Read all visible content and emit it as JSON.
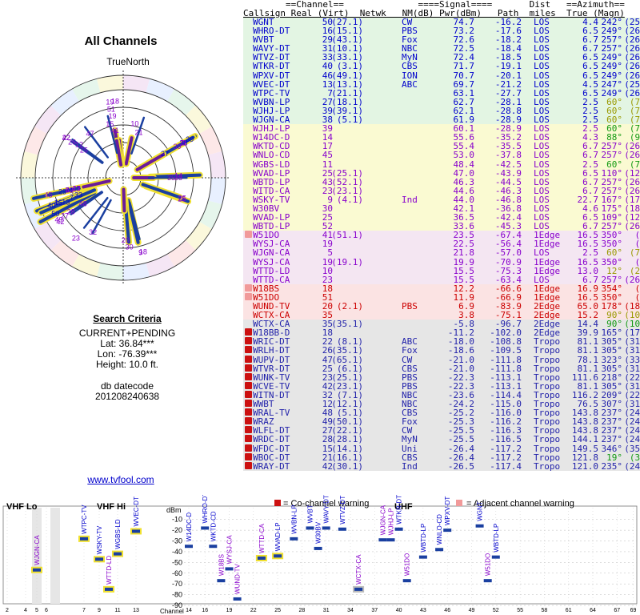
{
  "page": {
    "title": "All Channels",
    "true_north": "TrueNorth",
    "criteria_heading": "Search Criteria",
    "criteria_mode": "CURRENT+PENDING",
    "lat": "Lat: 36.84***",
    "lon": "Lon: -76.39***",
    "height": "Height: 10.0 ft.",
    "db_label": "db datecode",
    "db_value": "201208240638",
    "link": "www.tvfool.com"
  },
  "table": {
    "header1": "        ==Channel==              ====Signal====       Dist   ==Azimuth==",
    "header2": "Callsign Real (Virt)  Netwk   NM(dB) Pwr(dBm)   Path  miles  True (Magn)",
    "columns": [
      "Callsign",
      "Real",
      "(Virt)",
      "Netwk",
      "NM(dB)",
      "Pwr(dBm)",
      "Path",
      "Dist miles",
      "True",
      "(Magn)"
    ],
    "rows": [
      {
        "cs": "WGNT",
        "real": "50",
        "virt": "(27.1)",
        "net": "CW",
        "nm": "74.7",
        "pwr": "-16.2",
        "path": "LOS",
        "dist": "4.4",
        "tru": "242°",
        "mag": "(252°)",
        "grp": "g"
      },
      {
        "cs": "WHRO-DT",
        "real": "16",
        "virt": "(15.1)",
        "net": "PBS",
        "nm": "73.2",
        "pwr": "-17.6",
        "path": "LOS",
        "dist": "6.5",
        "tru": "249°",
        "mag": "(260°)",
        "grp": "g"
      },
      {
        "cs": "WVBT",
        "real": "29",
        "virt": "(43.1)",
        "net": "Fox",
        "nm": "72.6",
        "pwr": "-18.2",
        "path": "LOS",
        "dist": "6.7",
        "tru": "257°",
        "mag": "(268°)",
        "grp": "g"
      },
      {
        "cs": "WAVY-DT",
        "real": "31",
        "virt": "(10.1)",
        "net": "NBC",
        "nm": "72.5",
        "pwr": "-18.4",
        "path": "LOS",
        "dist": "6.7",
        "tru": "257°",
        "mag": "(268°)",
        "grp": "g"
      },
      {
        "cs": "WTVZ-DT",
        "real": "33",
        "virt": "(33.1)",
        "net": "MyN",
        "nm": "72.4",
        "pwr": "-18.5",
        "path": "LOS",
        "dist": "6.5",
        "tru": "249°",
        "mag": "(260°)",
        "grp": "g"
      },
      {
        "cs": "WTKR-DT",
        "real": "40",
        "virt": "(3.1)",
        "net": "CBS",
        "nm": "71.7",
        "pwr": "-19.1",
        "path": "LOS",
        "dist": "6.5",
        "tru": "249°",
        "mag": "(260°)",
        "grp": "g"
      },
      {
        "cs": "WPXV-DT",
        "real": "46",
        "virt": "(49.1)",
        "net": "ION",
        "nm": "70.7",
        "pwr": "-20.1",
        "path": "LOS",
        "dist": "6.5",
        "tru": "249°",
        "mag": "(260°)",
        "grp": "g"
      },
      {
        "cs": "WVEC-DT",
        "real": "13",
        "virt": "(13.1)",
        "net": "ABC",
        "nm": "69.7",
        "pwr": "-21.2",
        "path": "LOS",
        "dist": "4.5",
        "tru": "247°",
        "mag": "(258°)",
        "grp": "g"
      },
      {
        "cs": "WTPC-TV",
        "real": "7",
        "virt": "(21.1)",
        "net": "",
        "nm": "63.1",
        "pwr": "-27.7",
        "path": "LOS",
        "dist": "6.5",
        "tru": "249°",
        "mag": "(260°)",
        "grp": "g"
      },
      {
        "cs": "WVBN-LP",
        "real": "27",
        "virt": "(18.1)",
        "net": "",
        "nm": "62.7",
        "pwr": "-28.1",
        "path": "LOS",
        "dist": "2.5",
        "tru": "60°",
        "mag": "(70°)",
        "grp": "g"
      },
      {
        "cs": "WJHJ-LP",
        "real": "39",
        "virt": "(39.1)",
        "net": "",
        "nm": "62.1",
        "pwr": "-28.8",
        "path": "LOS",
        "dist": "2.5",
        "tru": "60°",
        "mag": "(70°)",
        "grp": "g"
      },
      {
        "cs": "WJGN-CA",
        "real": "38",
        "virt": "(5.1)",
        "net": "",
        "nm": "61.9",
        "pwr": "-28.9",
        "path": "LOS",
        "dist": "2.5",
        "tru": "60°",
        "mag": "(70°)",
        "grp": "g"
      },
      {
        "cs": "WJHJ-LP",
        "real": "39",
        "virt": "",
        "net": "",
        "nm": "60.1",
        "pwr": "-28.9",
        "path": "LOS",
        "dist": "2.5",
        "tru": "60°",
        "mag": "(70°)",
        "grp": "y"
      },
      {
        "cs": "W14DC-D",
        "real": "14",
        "virt": "",
        "net": "",
        "nm": "55.6",
        "pwr": "-35.2",
        "path": "LOS",
        "dist": "4.3",
        "tru": "88°",
        "mag": "(98°)",
        "grp": "y"
      },
      {
        "cs": "WKTD-CD",
        "real": "17",
        "virt": "",
        "net": "",
        "nm": "55.4",
        "pwr": "-35.5",
        "path": "LOS",
        "dist": "6.7",
        "tru": "257°",
        "mag": "(268°)",
        "grp": "y"
      },
      {
        "cs": "WNLO-CD",
        "real": "45",
        "virt": "",
        "net": "",
        "nm": "53.0",
        "pwr": "-37.8",
        "path": "LOS",
        "dist": "6.7",
        "tru": "257°",
        "mag": "(268°)",
        "grp": "y"
      },
      {
        "cs": "WGBS-LD",
        "real": "11",
        "virt": "",
        "net": "",
        "nm": "48.4",
        "pwr": "-42.5",
        "path": "LOS",
        "dist": "2.5",
        "tru": "60°",
        "mag": "(70°)",
        "grp": "y"
      },
      {
        "cs": "WVAD-LP",
        "real": "25",
        "virt": "(25.1)",
        "net": "",
        "nm": "47.0",
        "pwr": "-43.9",
        "path": "LOS",
        "dist": "6.5",
        "tru": "110°",
        "mag": "(120°)",
        "grp": "y"
      },
      {
        "cs": "WBTD-LP",
        "real": "43",
        "virt": "(52.1)",
        "net": "",
        "nm": "46.3",
        "pwr": "-44.5",
        "path": "LOS",
        "dist": "6.7",
        "tru": "257°",
        "mag": "(268°)",
        "grp": "y"
      },
      {
        "cs": "WITD-CA",
        "real": "23",
        "virt": "(23.1)",
        "net": "",
        "nm": "44.6",
        "pwr": "-46.3",
        "path": "LOS",
        "dist": "6.7",
        "tru": "257°",
        "mag": "(268°)",
        "grp": "y"
      },
      {
        "cs": "WSKY-TV",
        "real": "9",
        "virt": "(4.1)",
        "net": "Ind",
        "nm": "44.0",
        "pwr": "-46.8",
        "path": "LOS",
        "dist": "22.7",
        "tru": "167°",
        "mag": "(178°)",
        "grp": "y"
      },
      {
        "cs": "W30BV",
        "real": "30",
        "virt": "",
        "net": "",
        "nm": "42.1",
        "pwr": "-36.8",
        "path": "LOS",
        "dist": "4.6",
        "tru": "175°",
        "mag": "(186°)",
        "grp": "y"
      },
      {
        "cs": "WVAD-LP",
        "real": "25",
        "virt": "",
        "net": "",
        "nm": "36.5",
        "pwr": "-42.4",
        "path": "LOS",
        "dist": "6.5",
        "tru": "109°",
        "mag": "(120°)",
        "grp": "y"
      },
      {
        "cs": "WBTD-LP",
        "real": "52",
        "virt": "",
        "net": "",
        "nm": "33.6",
        "pwr": "-45.3",
        "path": "LOS",
        "dist": "6.7",
        "tru": "257°",
        "mag": "(268°)",
        "grp": "y"
      },
      {
        "cs": "W51DO",
        "real": "41",
        "virt": "(51.1)",
        "net": "",
        "nm": "23.5",
        "pwr": "-67.4",
        "path": "1Edge",
        "dist": "16.5",
        "tru": "350°",
        "mag": "(0°)",
        "grp": "p",
        "mk": "adj"
      },
      {
        "cs": "WYSJ-CA",
        "real": "19",
        "virt": "",
        "net": "",
        "nm": "22.5",
        "pwr": "-56.4",
        "path": "1Edge",
        "dist": "16.5",
        "tru": "350°",
        "mag": "(0°)",
        "grp": "p"
      },
      {
        "cs": "WJGN-CA",
        "real": "5",
        "virt": "",
        "net": "",
        "nm": "21.8",
        "pwr": "-57.0",
        "path": "LOS",
        "dist": "2.5",
        "tru": "60°",
        "mag": "(70°)",
        "grp": "p"
      },
      {
        "cs": "WYSJ-CA",
        "real": "19",
        "virt": "(19.1)",
        "net": "",
        "nm": "19.9",
        "pwr": "-70.9",
        "path": "1Edge",
        "dist": "16.5",
        "tru": "350°",
        "mag": "(0°)",
        "grp": "p"
      },
      {
        "cs": "WTTD-LD",
        "real": "10",
        "virt": "",
        "net": "",
        "nm": "15.5",
        "pwr": "-75.3",
        "path": "1Edge",
        "dist": "13.0",
        "tru": "12°",
        "mag": "(23°)",
        "grp": "p"
      },
      {
        "cs": "WTTD-CA",
        "real": "23",
        "virt": "",
        "net": "",
        "nm": "15.5",
        "pwr": "-63.4",
        "path": "LOS",
        "dist": "6.7",
        "tru": "257°",
        "mag": "(268°)",
        "grp": "p"
      },
      {
        "cs": "W18BS",
        "real": "18",
        "virt": "",
        "net": "",
        "nm": "12.2",
        "pwr": "-66.6",
        "path": "1Edge",
        "dist": "16.9",
        "tru": "354°",
        "mag": "(4°)",
        "grp": "r",
        "mk": "adj"
      },
      {
        "cs": "W51DO",
        "real": "51",
        "virt": "",
        "net": "",
        "nm": "11.9",
        "pwr": "-66.9",
        "path": "1Edge",
        "dist": "16.5",
        "tru": "350°",
        "mag": "(0°)",
        "grp": "r",
        "mk": "adj"
      },
      {
        "cs": "WUND-TV",
        "real": "20",
        "virt": "(2.1)",
        "net": "PBS",
        "nm": "6.9",
        "pwr": "-83.9",
        "path": "2Edge",
        "dist": "65.0",
        "tru": "178°",
        "mag": "(188°)",
        "grp": "r"
      },
      {
        "cs": "WCTX-CA",
        "real": "35",
        "virt": "",
        "net": "",
        "nm": "3.8",
        "pwr": "-75.1",
        "path": "2Edge",
        "dist": "15.2",
        "tru": "90°",
        "mag": "(100°)",
        "grp": "r"
      },
      {
        "cs": "WCTX-CA",
        "real": "35",
        "virt": "(35.1)",
        "net": "",
        "nm": "-5.8",
        "pwr": "-96.7",
        "path": "2Edge",
        "dist": "14.4",
        "tru": "90°",
        "mag": "(100°)",
        "grp": "k"
      },
      {
        "cs": "W18BB-D",
        "real": "18",
        "virt": "",
        "net": "",
        "nm": "-11.2",
        "pwr": "-102.0",
        "path": "2Edge",
        "dist": "39.9",
        "tru": "165°",
        "mag": "(176°)",
        "grp": "k",
        "mk": "co"
      },
      {
        "cs": "WRIC-DT",
        "real": "22",
        "virt": "(8.1)",
        "net": "ABC",
        "nm": "-18.0",
        "pwr": "-108.8",
        "path": "Tropo",
        "dist": "81.1",
        "tru": "305°",
        "mag": "(316°)",
        "grp": "k",
        "mk": "co"
      },
      {
        "cs": "WRLH-DT",
        "real": "26",
        "virt": "(35.1)",
        "net": "Fox",
        "nm": "-18.6",
        "pwr": "-109.5",
        "path": "Tropo",
        "dist": "81.1",
        "tru": "305°",
        "mag": "(316°)",
        "grp": "k",
        "mk": "co"
      },
      {
        "cs": "WUPV-DT",
        "real": "47",
        "virt": "(65.1)",
        "net": "CW",
        "nm": "-21.0",
        "pwr": "-111.8",
        "path": "Tropo",
        "dist": "78.1",
        "tru": "323°",
        "mag": "(333°)",
        "grp": "k",
        "mk": "co"
      },
      {
        "cs": "WTVR-DT",
        "real": "25",
        "virt": "(6.1)",
        "net": "CBS",
        "nm": "-21.0",
        "pwr": "-111.8",
        "path": "Tropo",
        "dist": "81.1",
        "tru": "305°",
        "mag": "(316°)",
        "grp": "k",
        "mk": "co"
      },
      {
        "cs": "WUNK-TV",
        "real": "23",
        "virt": "(25.1)",
        "net": "PBS",
        "nm": "-22.3",
        "pwr": "-113.1",
        "path": "Tropo",
        "dist": "111.6",
        "tru": "218°",
        "mag": "(228°)",
        "grp": "k",
        "mk": "co"
      },
      {
        "cs": "WCVE-TV",
        "real": "42",
        "virt": "(23.1)",
        "net": "PBS",
        "nm": "-22.3",
        "pwr": "-113.1",
        "path": "Tropo",
        "dist": "81.1",
        "tru": "305°",
        "mag": "(316°)",
        "grp": "k",
        "mk": "co"
      },
      {
        "cs": "WITN-DT",
        "real": "32",
        "virt": "(7.1)",
        "net": "NBC",
        "nm": "-23.6",
        "pwr": "-114.4",
        "path": "Tropo",
        "dist": "116.2",
        "tru": "209°",
        "mag": "(220°)",
        "grp": "k",
        "mk": "co"
      },
      {
        "cs": "WWBT",
        "real": "12",
        "virt": "(12.1)",
        "net": "NBC",
        "nm": "-24.2",
        "pwr": "-115.0",
        "path": "Tropo",
        "dist": "76.5",
        "tru": "307°",
        "mag": "(318°)",
        "grp": "k",
        "mk": "co"
      },
      {
        "cs": "WRAL-TV",
        "real": "48",
        "virt": "(5.1)",
        "net": "CBS",
        "nm": "-25.2",
        "pwr": "-116.0",
        "path": "Tropo",
        "dist": "143.8",
        "tru": "237°",
        "mag": "(247°)",
        "grp": "k",
        "mk": "co"
      },
      {
        "cs": "WRAZ",
        "real": "49",
        "virt": "(50.1)",
        "net": "Fox",
        "nm": "-25.3",
        "pwr": "-116.2",
        "path": "Tropo",
        "dist": "143.8",
        "tru": "237°",
        "mag": "(247°)",
        "grp": "k",
        "mk": "co"
      },
      {
        "cs": "WLFL-DT",
        "real": "27",
        "virt": "(22.1)",
        "net": "CW",
        "nm": "-25.5",
        "pwr": "-116.3",
        "path": "Tropo",
        "dist": "143.8",
        "tru": "237°",
        "mag": "(247°)",
        "grp": "k",
        "mk": "co"
      },
      {
        "cs": "WRDC-DT",
        "real": "28",
        "virt": "(28.1)",
        "net": "MyN",
        "nm": "-25.5",
        "pwr": "-116.5",
        "path": "Tropo",
        "dist": "144.1",
        "tru": "237°",
        "mag": "(247°)",
        "grp": "k",
        "mk": "co"
      },
      {
        "cs": "WFDC-DT",
        "real": "15",
        "virt": "(14.1)",
        "net": "Uni",
        "nm": "-26.4",
        "pwr": "-117.2",
        "path": "Tropo",
        "dist": "149.5",
        "tru": "346°",
        "mag": "(356°)",
        "grp": "k",
        "mk": "co"
      },
      {
        "cs": "WBOC-DT",
        "real": "21",
        "virty": "",
        "virt": "(16.1)",
        "net": "CBS",
        "nm": "-26.4",
        "pwr": "-117.2",
        "path": "Tropo",
        "dist": "121.8",
        "tru": "19°",
        "mag": "(30°)",
        "grp": "k",
        "mk": "co"
      },
      {
        "cs": "WRAY-DT",
        "real": "42",
        "virt": "(30.1)",
        "net": "Ind",
        "nm": "-26.5",
        "pwr": "-117.4",
        "path": "Tropo",
        "dist": "121.0",
        "tru": "235°",
        "mag": "(246°)",
        "grp": "k",
        "mk": "co"
      }
    ]
  },
  "spectrum": {
    "vhf_lo": "VHF Lo",
    "vhf_hi": "VHF Hi",
    "uhf": "UHF",
    "co_warning": "= Co-channel warning",
    "adj_warning": "= Adjacent channel warning",
    "dbm_label": "dBm",
    "channel_label": "Channel",
    "dbm_ticks": [
      "-10",
      "-20",
      "-30",
      "-40",
      "-50",
      "-60",
      "-70",
      "-80",
      "-90"
    ],
    "ch_ticks": [
      "2",
      "4",
      "5",
      "6",
      "7",
      "9",
      "11",
      "13",
      "14",
      "16",
      "19",
      "22",
      "25",
      "28",
      "31",
      "34",
      "37",
      "40",
      "43",
      "46",
      "49",
      "52",
      "55",
      "58",
      "61",
      "64",
      "67",
      "69"
    ],
    "stations": [
      {
        "label": "WJGN-CA",
        "ch": 5,
        "dbm": -57,
        "hl": "y"
      },
      {
        "label": "WTPC-TV",
        "ch": 7,
        "dbm": -28,
        "hl": "y"
      },
      {
        "label": "WSKY-TV",
        "ch": 9,
        "dbm": -47,
        "hl": "y"
      },
      {
        "label": "WTTD-LD",
        "ch": 10,
        "dbm": -75,
        "hl": "y"
      },
      {
        "label": "WGBS-LD",
        "ch": 11,
        "dbm": -42,
        "hl": "y"
      },
      {
        "label": "WVEC-DT",
        "ch": 13,
        "dbm": -21,
        "hl": "y"
      },
      {
        "label": "W14DC-D",
        "ch": 14,
        "dbm": -35,
        "hl": ""
      },
      {
        "label": "WHRO-DT",
        "ch": 16,
        "dbm": -18,
        "hl": ""
      },
      {
        "label": "WKTD-CD",
        "ch": 17,
        "dbm": -35,
        "hl": ""
      },
      {
        "label": "W18BS",
        "ch": 18,
        "dbm": -67,
        "hl": ""
      },
      {
        "label": "WYSJ-CA",
        "ch": 19,
        "dbm": -56,
        "hl": ""
      },
      {
        "label": "WUND-TV",
        "ch": 20,
        "dbm": -84,
        "hl": ""
      },
      {
        "label": "WTTD-CA",
        "ch": 23,
        "dbm": -46,
        "hl": "y"
      },
      {
        "label": "WVAD-LP",
        "ch": 25,
        "dbm": -44,
        "hl": "y"
      },
      {
        "label": "WVBN-LP",
        "ch": 27,
        "dbm": -28,
        "hl": ""
      },
      {
        "label": "WVBT",
        "ch": 29,
        "dbm": -18,
        "hl": ""
      },
      {
        "label": "W30BV",
        "ch": 30,
        "dbm": -37,
        "hl": ""
      },
      {
        "label": "WAVY-DT",
        "ch": 31,
        "dbm": -18,
        "hl": ""
      },
      {
        "label": "WTVZ-DT",
        "ch": 33,
        "dbm": -19,
        "hl": ""
      },
      {
        "label": "WCTX-CA",
        "ch": 35,
        "dbm": -75,
        "hl": "g"
      },
      {
        "label": "WJGN-CA",
        "ch": 38,
        "dbm": -29,
        "hl": ""
      },
      {
        "label": "WJHJ-LP",
        "ch": 39,
        "dbm": -29,
        "hl": ""
      },
      {
        "label": "WTKR-DT",
        "ch": 40,
        "dbm": -19,
        "hl": ""
      },
      {
        "label": "W51DO",
        "ch": 41,
        "dbm": -67,
        "hl": ""
      },
      {
        "label": "WBTD-LP",
        "ch": 43,
        "dbm": -45,
        "hl": ""
      },
      {
        "label": "WNLO-CD",
        "ch": 45,
        "dbm": -38,
        "hl": ""
      },
      {
        "label": "WPXV-DT",
        "ch": 46,
        "dbm": -20,
        "hl": ""
      },
      {
        "label": "WGNT",
        "ch": 50,
        "dbm": -16,
        "hl": ""
      },
      {
        "label": "W51DO",
        "ch": 51,
        "dbm": -67,
        "hl": ""
      },
      {
        "label": "WBTD-LP",
        "ch": 52,
        "dbm": -45,
        "hl": ""
      }
    ]
  },
  "colors": {
    "green_row": "#e3f5e3",
    "yellow_row": "#fafad2",
    "purple_row": "#f4e6f2",
    "red_row": "#fbe3e3",
    "gray_row": "#e6e6e6",
    "green_text": "#0000cc",
    "purple_text": "#8800cc",
    "red_text": "#cc0000",
    "gray_text": "#2222aa",
    "bar_blue": "#1a3fa0",
    "bar_purple": "#6a1b9a",
    "highlight": "#f0e030",
    "magn_olive": "#999900",
    "magn_green": "#119911"
  }
}
